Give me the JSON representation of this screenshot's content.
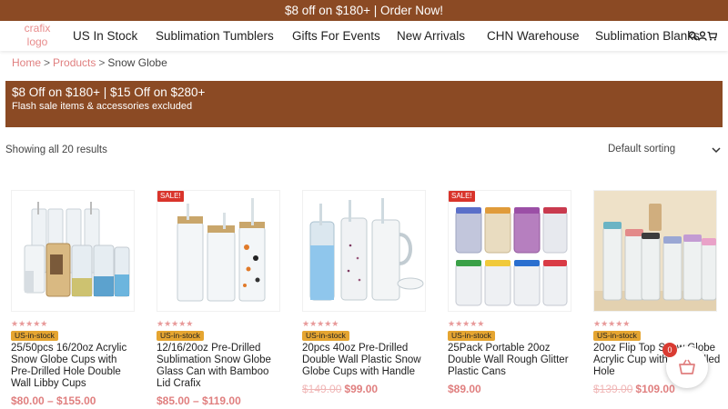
{
  "announcement": "$8 off on $180+ | Order Now!",
  "logo": "crafix logo",
  "nav": [
    "US In Stock",
    "Sublimation Tumblers",
    "Gifts For Events",
    "New Arrivals",
    "CHN Warehouse",
    "Sublimation Blanks"
  ],
  "header_icons": [
    "search-icon",
    "user-icon",
    "cart-icon"
  ],
  "breadcrumb": {
    "home": "Home",
    "separator": ">",
    "products": "Products",
    "current": "Snow Globe"
  },
  "promo": {
    "line1": "$8 Off on $180+ | $15 Off on $280+",
    "line2": "Flash sale items & accessories excluded"
  },
  "result_count": "Showing all 20 results",
  "sort": {
    "selected": "Default sorting"
  },
  "rating_stars": "★★★★★",
  "products": [
    {
      "sale": "",
      "stock": "US-in-stock",
      "title": "25/50pcs 16/20oz Acrylic Snow Globe Cups with Pre-Drilled Hole Double Wall Libby Cups",
      "old_price": "",
      "price": "$80.00 – $155.00"
    },
    {
      "sale": "SALE!",
      "stock": "US-in-stock",
      "title": "12/16/20oz Pre-Drilled Sublimation Snow Globe Glass Can with Bamboo Lid Crafix",
      "old_price": "",
      "price": "$85.00 – $119.00"
    },
    {
      "sale": "",
      "stock": "US-in-stock",
      "title": "20pcs 40oz Pre-Drilled Double Wall Plastic Snow Globe Cups with Handle",
      "old_price": "$149.00",
      "price": "$99.00"
    },
    {
      "sale": "SALE!",
      "stock": "US-in-stock",
      "title": "25Pack Portable 20oz Double Wall Rough Glitter Plastic Cans",
      "old_price": "",
      "price": "$89.00"
    },
    {
      "sale": "",
      "stock": "US-in-stock",
      "title": "20oz Flip Top Snow Globe Acrylic Cup with Pre-Drilled Hole",
      "old_price": "$139.00",
      "price": "$109.00"
    }
  ],
  "cart": {
    "count": "0"
  },
  "colors": {
    "brand_brown": "#8b4a24",
    "link_pink": "#e07f7f",
    "stock_badge": "#e5a531",
    "sale_red": "#d9342b"
  }
}
